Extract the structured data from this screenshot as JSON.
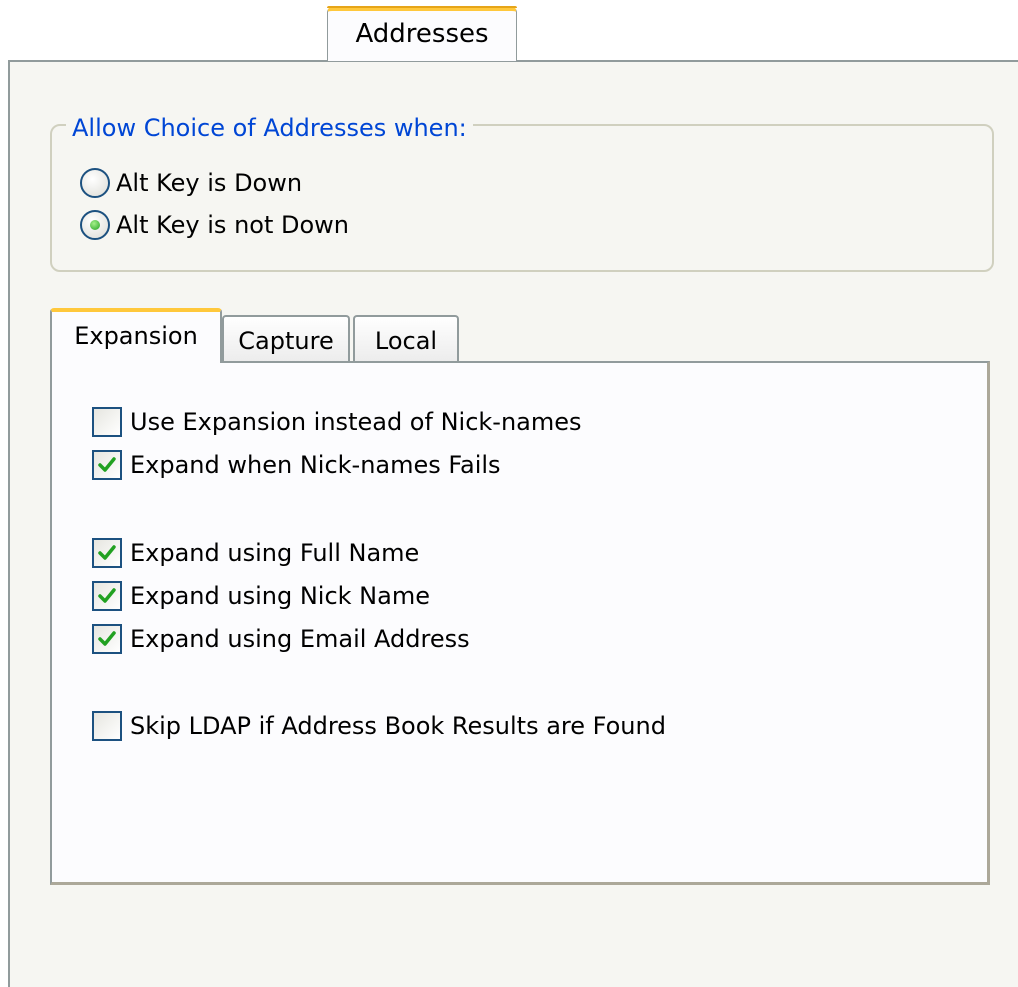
{
  "tabs": {
    "outer_tab_label": "Addresses",
    "inner": [
      {
        "label": "Expansion",
        "active": true
      },
      {
        "label": "Capture",
        "active": false
      },
      {
        "label": "Local",
        "active": false
      }
    ]
  },
  "address_choice": {
    "legend": "Allow Choice of Addresses when:",
    "options": [
      {
        "label": "Alt Key is Down",
        "selected": false
      },
      {
        "label": "Alt Key is not Down",
        "selected": true
      }
    ]
  },
  "expansion": {
    "checkboxes": [
      {
        "label": "Use Expansion instead of Nick-names",
        "checked": false
      },
      {
        "label": "Expand when Nick-names Fails",
        "checked": true
      },
      {
        "label": "Expand using Full Name",
        "checked": true
      },
      {
        "label": "Expand using Nick Name",
        "checked": true
      },
      {
        "label": "Expand using Email Address",
        "checked": true
      },
      {
        "label": "Skip LDAP if Address Book Results are Found",
        "checked": false
      }
    ]
  },
  "colors": {
    "accent_tab": "#ffc83c",
    "legend_text": "#0046d5",
    "check_green": "#21a121"
  },
  "icons": {
    "check": "checkmark-icon",
    "radio": "radio-dot-icon"
  }
}
